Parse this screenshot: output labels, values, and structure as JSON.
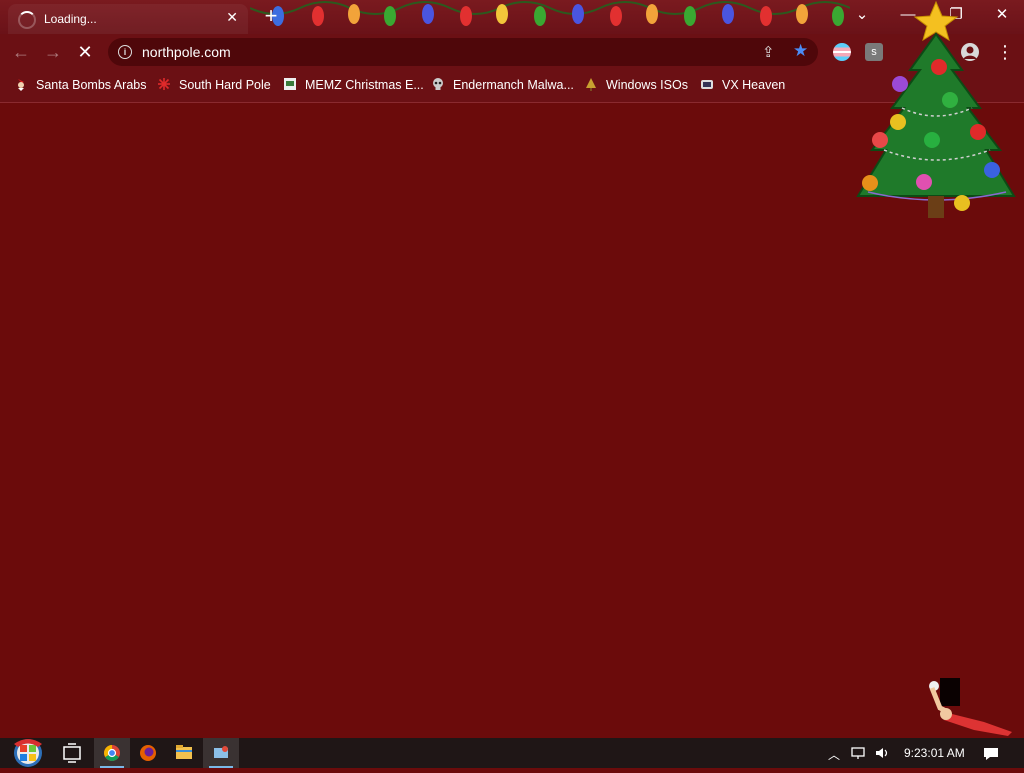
{
  "browser": {
    "tab": {
      "title": "Loading...",
      "close_glyph": "✕"
    },
    "new_tab_glyph": "+",
    "window_controls": {
      "tabsearch": "⌄",
      "minimize": "—",
      "restore": "❐",
      "close": "✕"
    }
  },
  "toolbar": {
    "back_glyph": "←",
    "forward_glyph": "→",
    "stop_glyph": "✕",
    "url": "northpole.com",
    "menu_glyph": "⋮",
    "extensions": [
      {
        "name": "flag-extension-icon",
        "color": "#e8e8f0"
      },
      {
        "name": "s-extension-icon",
        "color": "#8a8a8a",
        "label": "s"
      }
    ],
    "bookmark_star_color": "#4b8cf5"
  },
  "bookmarks": [
    {
      "label": "Santa Bombs Arabs",
      "icon": "santa-icon"
    },
    {
      "label": "South Hard Pole",
      "icon": "snowflake-icon"
    },
    {
      "label": "MEMZ Christmas E...",
      "icon": "memz-icon"
    },
    {
      "label": "Endermanch Malwa...",
      "icon": "skull-icon"
    },
    {
      "label": "Windows ISOs",
      "icon": "tree-icon"
    },
    {
      "label": "VX Heaven",
      "icon": "vx-icon"
    }
  ],
  "taskbar": {
    "apps": [
      "start-button",
      "task-view",
      "chrome",
      "firefox",
      "file-explorer",
      "misc-app"
    ],
    "clock": "9:23:01 AM"
  },
  "colors": {
    "page_bg": "#6b0b0b",
    "chrome_bg": "#6b1014",
    "omnibox_bg": "#4f070a",
    "taskbar_bg": "#1f1616"
  }
}
